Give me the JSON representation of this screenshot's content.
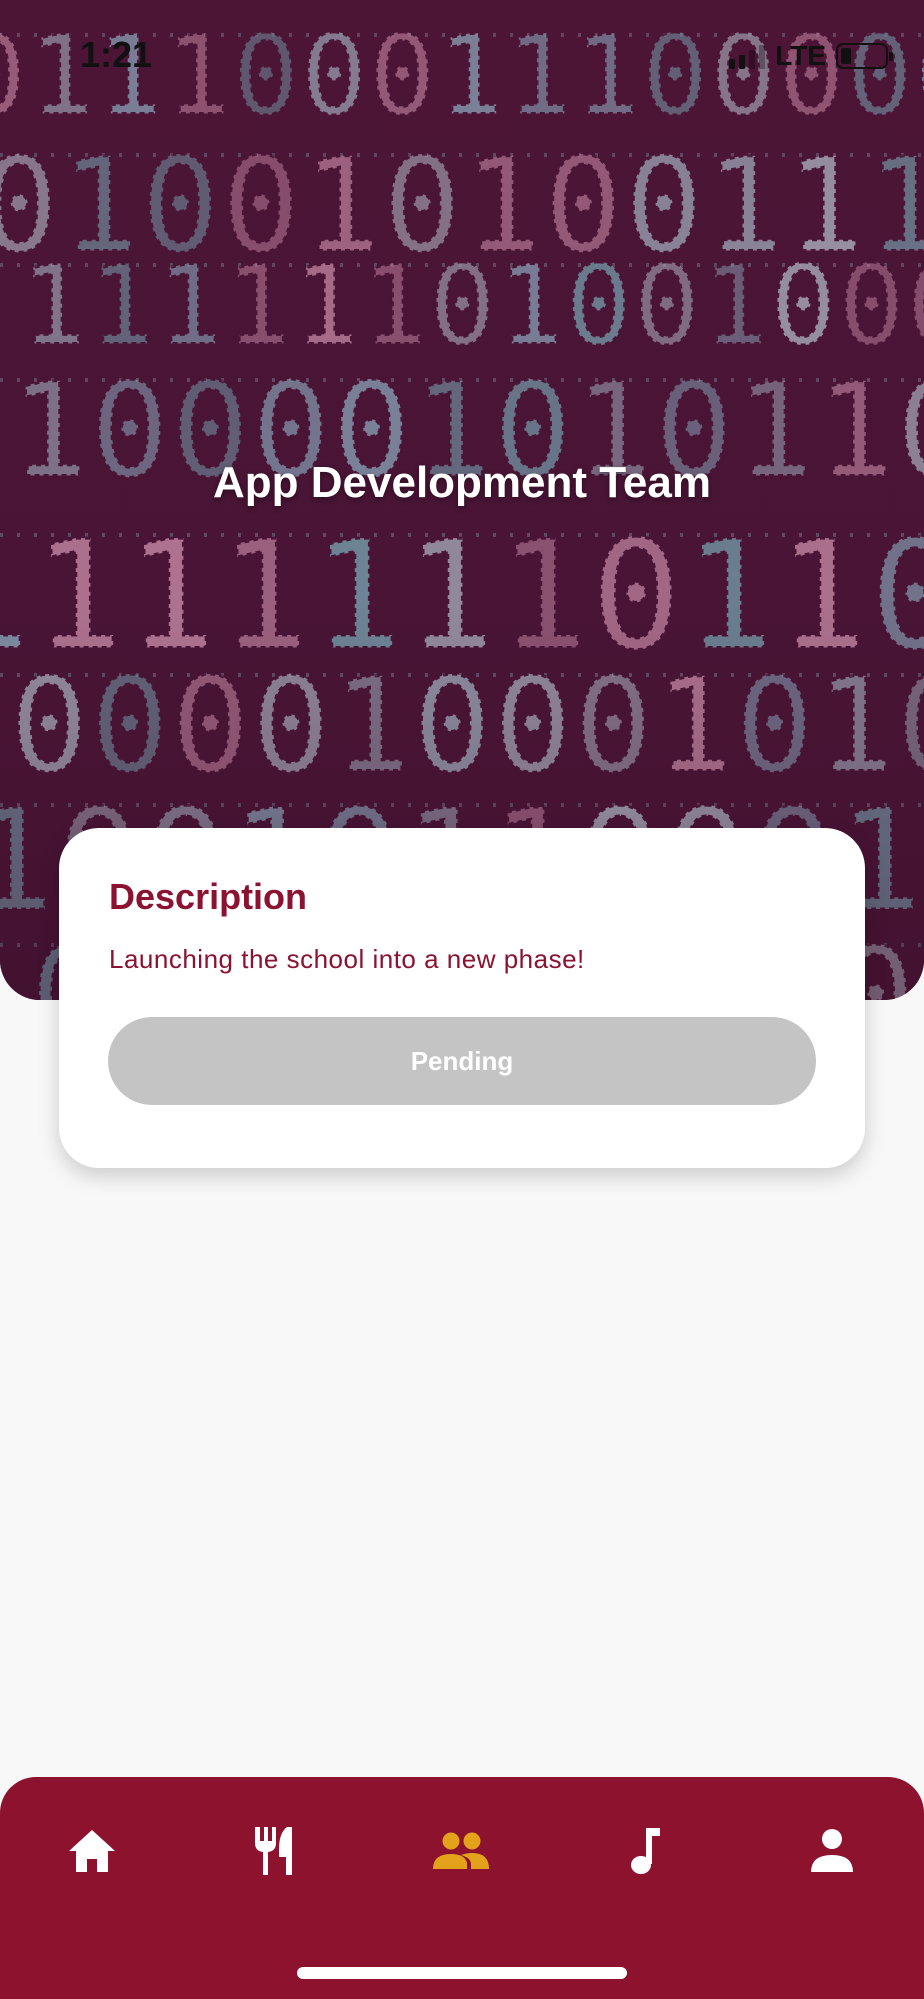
{
  "status_bar": {
    "time": "1:21",
    "network": "LTE"
  },
  "hero": {
    "title": "App Development Team"
  },
  "card": {
    "heading": "Description",
    "description": "Launching the school into a new phase!",
    "status_button": "Pending"
  },
  "tab_bar": {
    "items": [
      {
        "icon": "home-icon",
        "active": false
      },
      {
        "icon": "dining-icon",
        "active": false
      },
      {
        "icon": "group-icon",
        "active": true
      },
      {
        "icon": "music-note-icon",
        "active": false
      },
      {
        "icon": "person-icon",
        "active": false
      }
    ],
    "active_color": "#e3a21a",
    "inactive_color": "#ffffff",
    "background": "#8c122e"
  },
  "colors": {
    "accent": "#8b1230",
    "pending": "#c4c4c4"
  }
}
